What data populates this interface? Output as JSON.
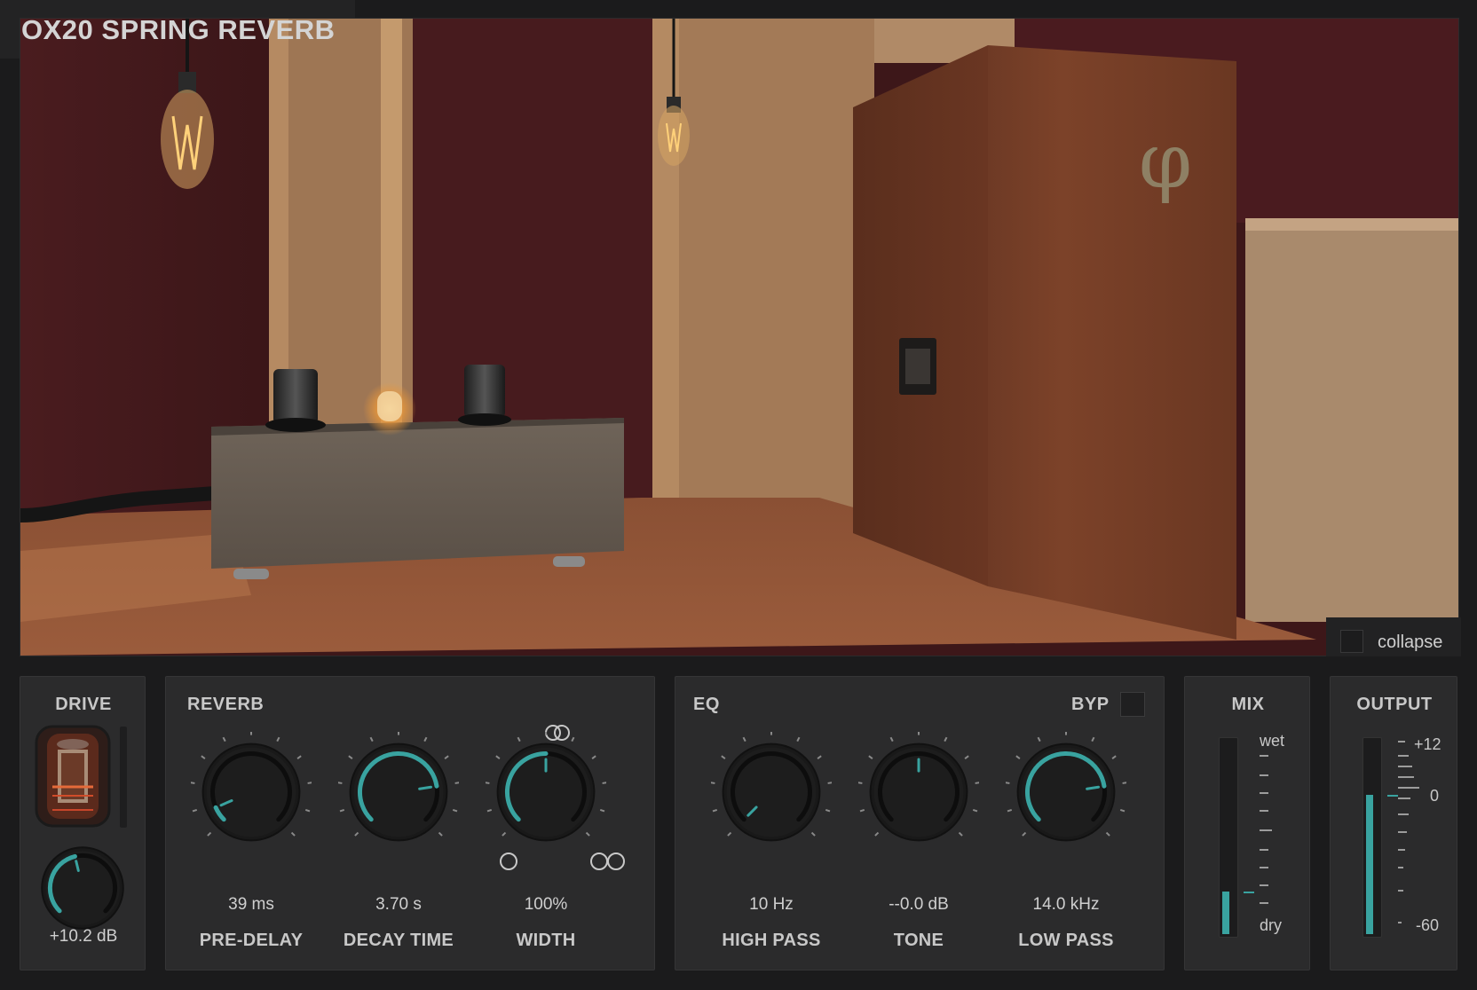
{
  "app": {
    "title": "OX20 SPRING REVERB",
    "collapse_label": "collapse"
  },
  "colors": {
    "accent": "#39a3a0",
    "panel": "#2b2b2c",
    "background": "#1b1b1c"
  },
  "drive": {
    "title": "DRIVE",
    "value": "+10.2 dB",
    "level": 0.45
  },
  "reverb": {
    "title": "REVERB",
    "pre_delay": {
      "value": "39 ms",
      "label": "PRE-DELAY",
      "level": 0.08
    },
    "decay_time": {
      "value": "3.70 s",
      "label": "DECAY TIME",
      "level": 0.8
    },
    "width": {
      "value": "100%",
      "label": "WIDTH",
      "level": 0.5
    }
  },
  "eq": {
    "title": "EQ",
    "bypass_label": "BYP",
    "high_pass": {
      "value": "10 Hz",
      "label": "HIGH PASS",
      "level": 0.0
    },
    "tone": {
      "value": "--0.0 dB",
      "label": "TONE",
      "level": 0.5
    },
    "low_pass": {
      "value": "14.0 kHz",
      "label": "LOW PASS",
      "level": 0.8
    }
  },
  "mix": {
    "title": "MIX",
    "wet_label": "wet",
    "dry_label": "dry",
    "level": 0.22
  },
  "output": {
    "title": "OUTPUT",
    "scale_top": "+12",
    "scale_mid": "0",
    "scale_bottom": "-60",
    "level": 0.72
  }
}
